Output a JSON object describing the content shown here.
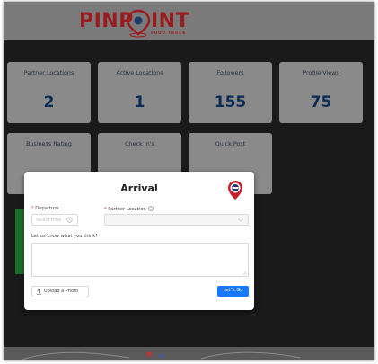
{
  "brand": {
    "name_part1": "PINP",
    "name_part2": "INT",
    "tagline": "FOOD TRUCK",
    "color": "#9a1b1f"
  },
  "stats": [
    {
      "title": "Partner Locations",
      "value": "2"
    },
    {
      "title": "Active Locations",
      "value": "1"
    },
    {
      "title": "Followers",
      "value": "155"
    },
    {
      "title": "Profile Views",
      "value": "75"
    },
    {
      "title": "Business Rating",
      "value": ""
    },
    {
      "title": "Check In's",
      "value": ""
    },
    {
      "title": "Quick Post",
      "value": ""
    }
  ],
  "modal": {
    "title": "Arrival",
    "departure_label": "Departure",
    "departure_placeholder": "Select time",
    "partner_location_label": "Partner Location",
    "partner_location_help_icon": "info-circle-icon",
    "feedback_label": "Let us know what you think!",
    "feedback_value": "",
    "upload_label": "Upload a Photo",
    "upload_icon": "upload-icon",
    "submit_label": "Let\"s Go"
  },
  "colors": {
    "primary": "#1677ff",
    "stat_value": "#0b2c54",
    "required": "#e0282e"
  }
}
